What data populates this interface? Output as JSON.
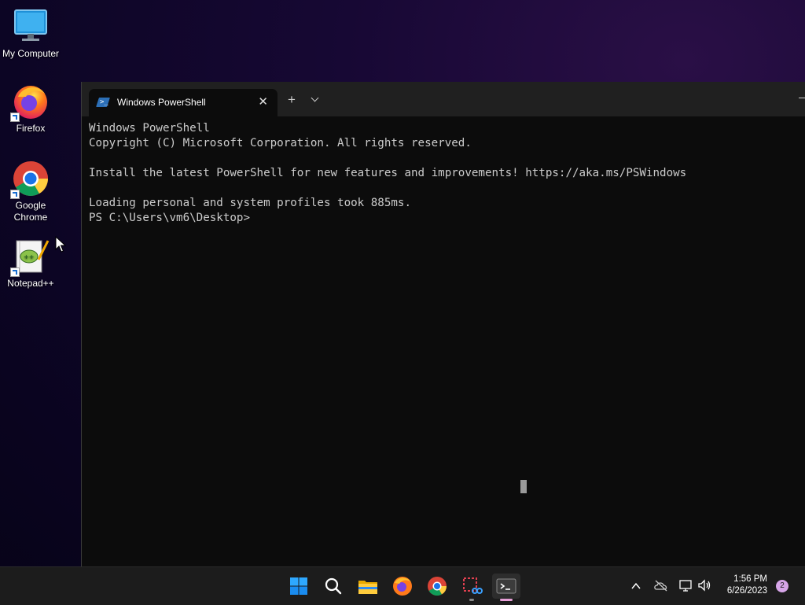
{
  "desktop": {
    "icons": [
      {
        "label": "My Computer",
        "icon": "monitor-icon"
      },
      {
        "label": "Firefox",
        "icon": "firefox-icon"
      },
      {
        "label": "Google Chrome",
        "icon": "chrome-icon"
      },
      {
        "label": "Notepad++",
        "icon": "notepadpp-icon"
      }
    ]
  },
  "terminal": {
    "tab_title": "Windows PowerShell",
    "tab_icon": "powershell-icon",
    "new_tab_label": "+",
    "close_label": "✕",
    "console_text": "Windows PowerShell\nCopyright (C) Microsoft Corporation. All rights reserved.\n\nInstall the latest PowerShell for new features and improvements! https://aka.ms/PSWindows\n\nLoading personal and system profiles took 885ms.\nPS C:\\Users\\vm6\\Desktop>",
    "background": "#0c0c0c",
    "text_color": "#cccccc"
  },
  "taskbar": {
    "apps": [
      "start-icon",
      "search-icon",
      "file-explorer-icon",
      "firefox-icon",
      "chrome-icon",
      "snipping-tool-icon",
      "terminal-icon"
    ],
    "active_app": "terminal-icon",
    "tray": {
      "time": "1:56 PM",
      "date": "6/26/2023",
      "notification_count": "2"
    }
  }
}
